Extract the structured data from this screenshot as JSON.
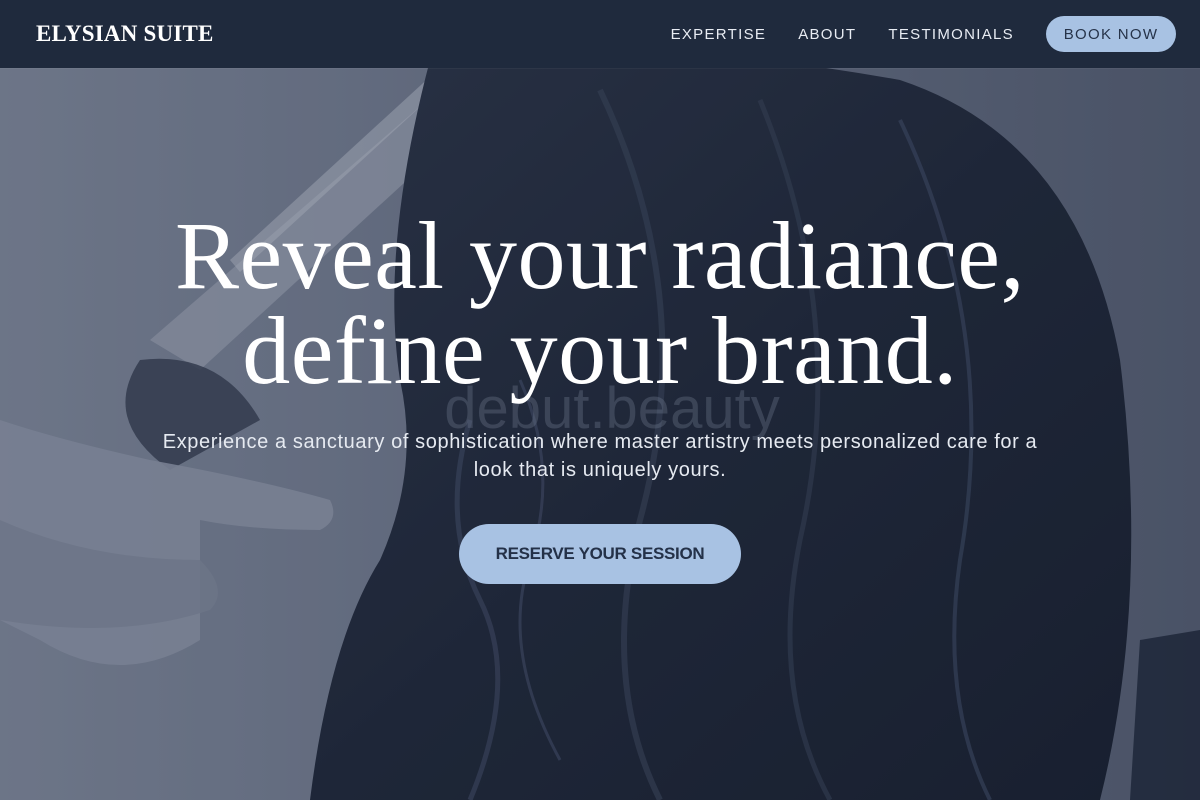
{
  "brand": {
    "logo_text": "ELYSIAN SUITE"
  },
  "nav": {
    "links": [
      {
        "label": "EXPERTISE"
      },
      {
        "label": "ABOUT"
      },
      {
        "label": "TESTIMONIALS"
      }
    ],
    "book_label": "BOOK NOW"
  },
  "hero": {
    "headline_line1": "Reveal your radiance,",
    "headline_line2": "define your brand.",
    "subtitle": "Experience a sanctuary of sophistication where master artistry meets personalized care for a look that is uniquely yours.",
    "cta_label": "RESERVE YOUR SESSION",
    "background_watermark": "debut.beauty"
  },
  "colors": {
    "header_bg": "#1f2a3d",
    "accent": "#a8c2e3",
    "accent_text": "#243148",
    "text_light": "#ffffff"
  }
}
